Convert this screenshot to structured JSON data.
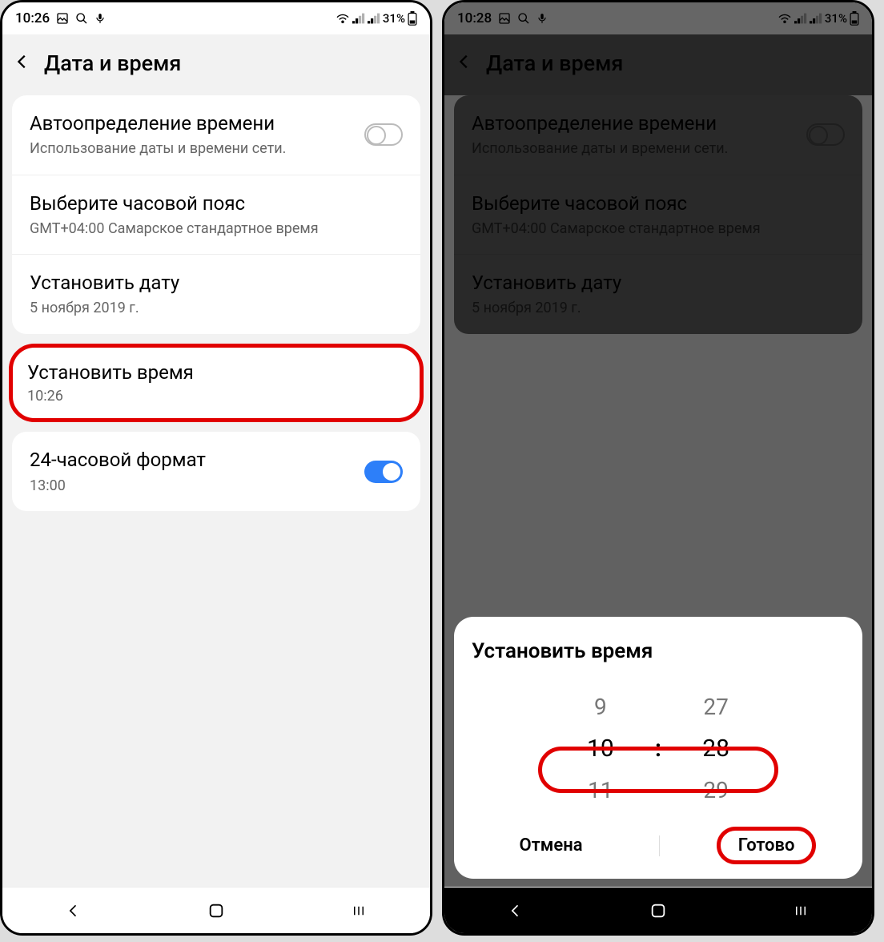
{
  "left": {
    "status": {
      "time": "10:26",
      "battery": "31%"
    },
    "header": "Дата и время",
    "auto": {
      "title": "Автоопределение времени",
      "sub": "Использование даты и времени сети."
    },
    "tz": {
      "title": "Выберите часовой пояс",
      "sub": "GMT+04:00 Самарское стандартное время"
    },
    "date": {
      "title": "Установить дату",
      "sub": "5 ноября 2019 г."
    },
    "time": {
      "title": "Установить время",
      "sub": "10:26"
    },
    "fmt": {
      "title": "24-часовой формат",
      "sub": "13:00"
    }
  },
  "right": {
    "status": {
      "time": "10:28",
      "battery": "31%"
    },
    "header": "Дата и время",
    "auto": {
      "title": "Автоопределение времени",
      "sub": "Использование даты и времени сети."
    },
    "tz": {
      "title": "Выберите часовой пояс",
      "sub": "GMT+04:00 Самарское стандартное время"
    },
    "date": {
      "title": "Установить дату",
      "sub": "5 ноября 2019 г."
    },
    "modal": {
      "title": "Установить время",
      "hours": {
        "prev": "9",
        "cur": "10",
        "next": "11"
      },
      "minutes": {
        "prev": "27",
        "cur": "28",
        "next": "29"
      },
      "sep": ":",
      "cancel": "Отмена",
      "done": "Готово"
    }
  }
}
